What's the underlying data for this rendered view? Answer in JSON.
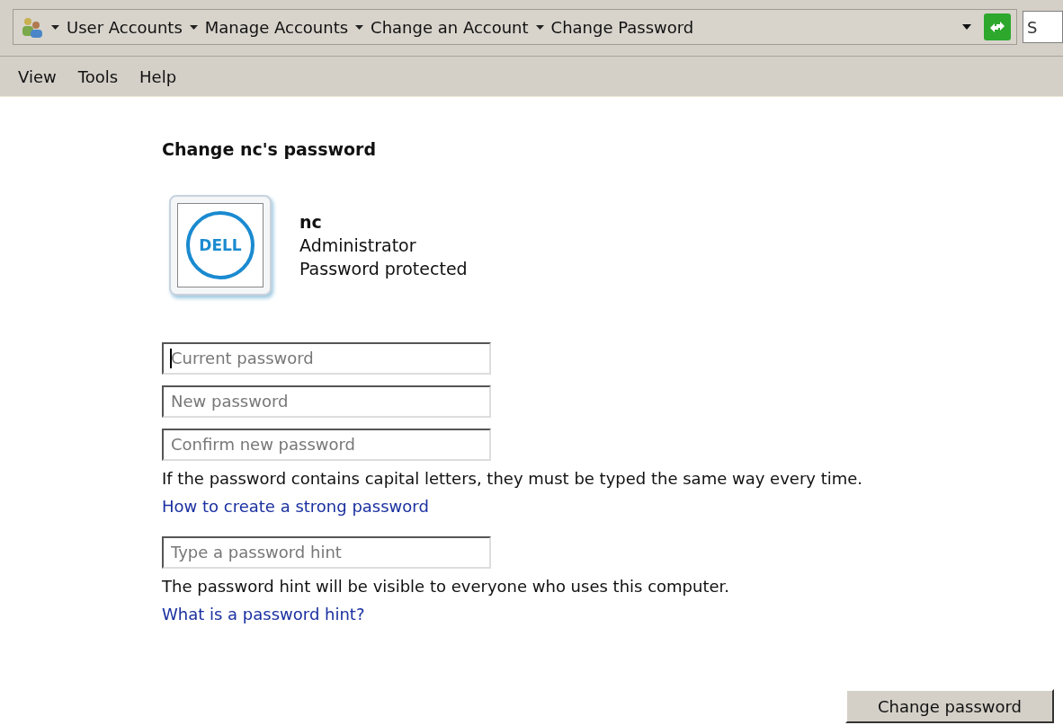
{
  "address_bar": {
    "breadcrumbs": [
      "User Accounts",
      "Manage Accounts",
      "Change an Account",
      "Change Password"
    ],
    "search": {
      "placeholder": "S"
    }
  },
  "menu": [
    "View",
    "Tools",
    "Help"
  ],
  "heading": "Change nc's password",
  "account": {
    "logo_text": "DELL",
    "name": "nc",
    "role": "Administrator",
    "status": "Password protected"
  },
  "fields": [
    {
      "placeholder": "Current password",
      "focused": true
    },
    {
      "placeholder": "New password",
      "focused": false
    },
    {
      "placeholder": "Confirm new password",
      "focused": false
    }
  ],
  "capital_note": "If the password contains capital letters, they must be typed the same way every time.",
  "strong_link": "How to create a strong password",
  "hint_field": {
    "placeholder": "Type a password hint"
  },
  "hint_note": "The password hint will be visible to everyone who uses this computer.",
  "hint_link": "What is a password hint?",
  "submit_button": "Change password"
}
